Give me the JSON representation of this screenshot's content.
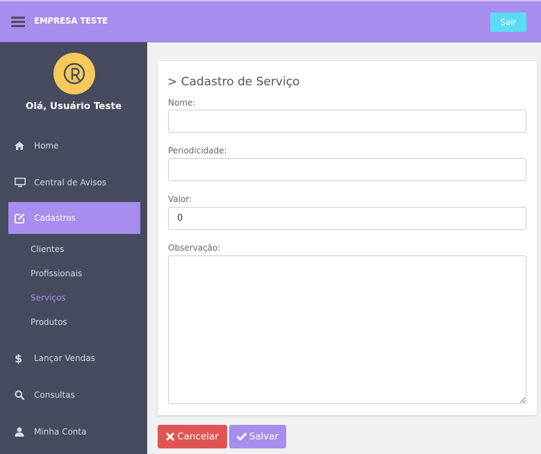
{
  "header": {
    "brand": "EMPRESA TESTE",
    "logout_label": "Sair"
  },
  "sidebar": {
    "greeting": "Olá, Usuário Teste",
    "items": [
      {
        "label": "Home",
        "icon": "home-icon"
      },
      {
        "label": "Central de Avisos",
        "icon": "monitor-icon"
      },
      {
        "label": "Cadastros",
        "icon": "edit-icon",
        "active": true
      },
      {
        "label": "Lançar Vendas",
        "icon": "dollar-icon"
      },
      {
        "label": "Consultas",
        "icon": "search-icon"
      },
      {
        "label": "Minha Conta",
        "icon": "user-icon"
      }
    ],
    "subitems": [
      {
        "label": "Clientes"
      },
      {
        "label": "Profissionais"
      },
      {
        "label": "Serviços",
        "active": true
      },
      {
        "label": "Produtos"
      }
    ]
  },
  "form": {
    "title": "> Cadastro de Serviço",
    "fields": {
      "nome": {
        "label": "Nome:",
        "value": ""
      },
      "periodicidade": {
        "label": "Periodicidade:",
        "value": ""
      },
      "valor": {
        "label": "Valor:",
        "value": "0"
      },
      "observacao": {
        "label": "Observação:",
        "value": ""
      }
    }
  },
  "actions": {
    "cancel_label": "Cancelar",
    "save_label": "Salvar"
  },
  "colors": {
    "accent": "#a78ded",
    "sidebar_bg": "#464b5f",
    "cancel": "#e05553",
    "logout": "#5bdbf3",
    "avatar": "#f6c95a"
  }
}
